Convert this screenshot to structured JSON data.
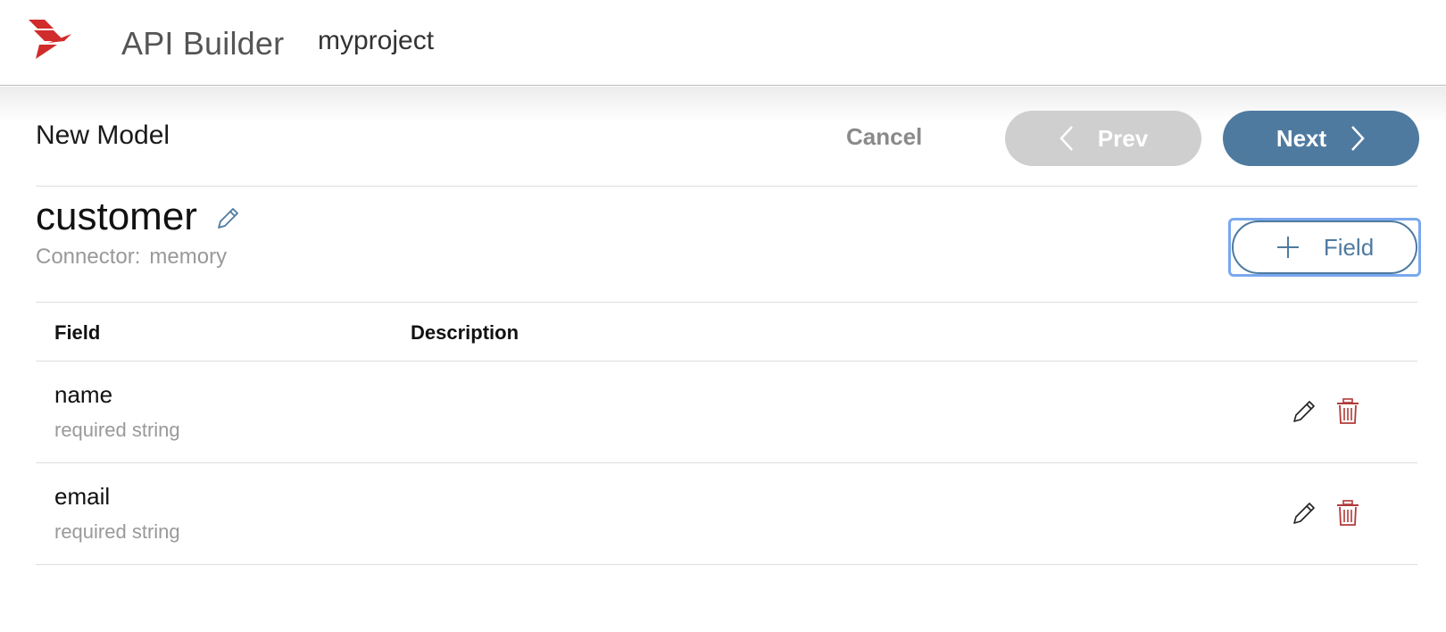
{
  "header": {
    "app_title": "API Builder",
    "project": "myproject",
    "logo_icon": "axway-logo",
    "logo_color": "#d12b2b"
  },
  "toolbar": {
    "page_title": "New Model",
    "cancel_label": "Cancel",
    "prev_label": "Prev",
    "next_label": "Next"
  },
  "model": {
    "name": "customer",
    "connector_label": "Connector:",
    "connector_value": "memory",
    "add_field_label": "Field"
  },
  "table": {
    "columns": [
      "Field",
      "Description"
    ],
    "rows": [
      {
        "name": "name",
        "type": "required string",
        "description": ""
      },
      {
        "name": "email",
        "type": "required string",
        "description": ""
      }
    ]
  },
  "colors": {
    "accent": "#4f7aa0",
    "disabled": "#cfcfcf",
    "delete": "#b23a3a",
    "focus_ring": "#7aa8ee"
  }
}
